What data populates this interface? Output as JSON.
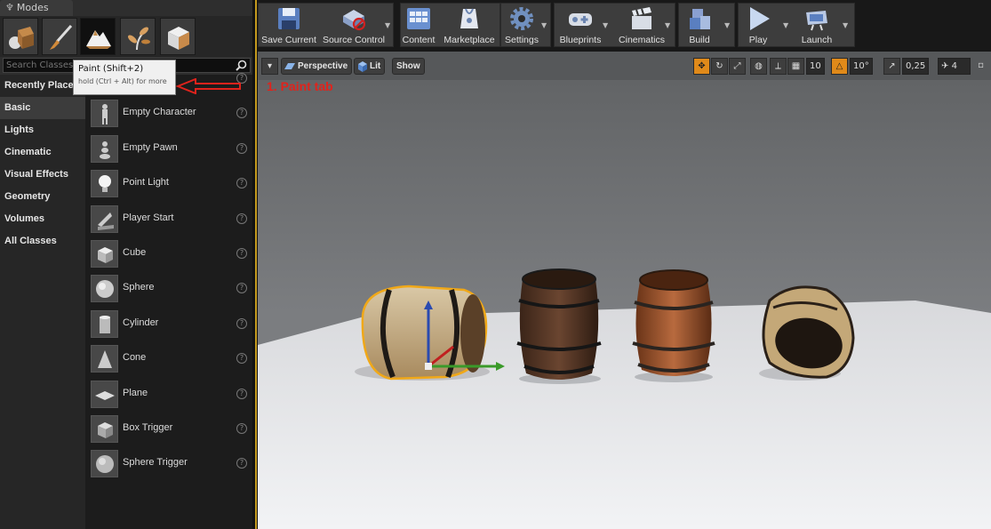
{
  "panel": {
    "tab_title": "Modes",
    "modes": [
      {
        "name": "place-mode",
        "icon": "place-icon"
      },
      {
        "name": "paint-mode",
        "icon": "paintbrush-icon"
      },
      {
        "name": "landscape-mode",
        "icon": "landscape-icon"
      },
      {
        "name": "foliage-mode",
        "icon": "foliage-icon"
      },
      {
        "name": "geometry-mode",
        "icon": "geometry-icon"
      }
    ],
    "search_placeholder": "Search Classes",
    "tooltip": {
      "title": "Paint (Shift+2)",
      "hint": "hold (Ctrl + Alt) for more"
    },
    "categories": [
      "Recently Placed",
      "Basic",
      "Lights",
      "Cinematic",
      "Visual Effects",
      "Geometry",
      "Volumes",
      "All Classes"
    ],
    "selected_category": "Basic",
    "items": [
      "",
      "Empty Character",
      "Empty Pawn",
      "Point Light",
      "Player Start",
      "Cube",
      "Sphere",
      "Cylinder",
      "Cone",
      "Plane",
      "Box Trigger",
      "Sphere Trigger"
    ]
  },
  "toolbar": {
    "buttons": [
      "Save Current",
      "Source Control",
      "Content",
      "Marketplace",
      "Settings",
      "Blueprints",
      "Cinematics",
      "Build",
      "Play",
      "Launch"
    ]
  },
  "viewport_bar": {
    "perspective": "Perspective",
    "lit": "Lit",
    "show": "Show",
    "grid_snap": "10",
    "rot_snap": "10°",
    "scale_snap": "0,25",
    "cam_speed": "4"
  },
  "annotation": "1. Paint tab",
  "colors": {
    "accent": "#c49a1e",
    "annotation": "#e0231c",
    "orange": "#e08a1a"
  }
}
